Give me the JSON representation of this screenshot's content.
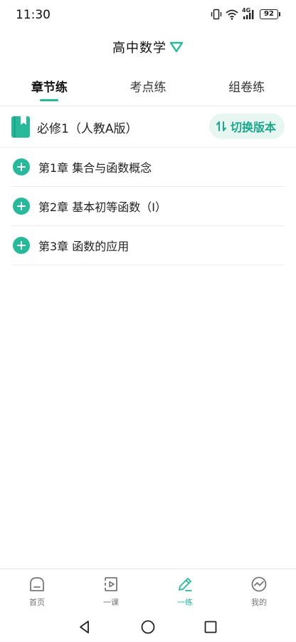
{
  "status_bar": {
    "time": "11:30",
    "network_label": "4G",
    "battery": "92"
  },
  "header": {
    "title": "高中数学",
    "dropdown_icon": "triangle-down-icon"
  },
  "tabs": [
    {
      "label": "章节练",
      "active": true
    },
    {
      "label": "考点练",
      "active": false
    },
    {
      "label": "组卷练",
      "active": false
    }
  ],
  "book": {
    "icon": "book-icon",
    "title": "必修1（人教A版）",
    "switch_label": "切换版本",
    "switch_icon": "swap-vertical-icon"
  },
  "chapters": [
    {
      "label": "第1章  集合与函数概念"
    },
    {
      "label": "第2章  基本初等函数（I）"
    },
    {
      "label": "第3章  函数的应用"
    }
  ],
  "bottom_nav": [
    {
      "label": "首页",
      "icon": "home-icon",
      "active": false
    },
    {
      "label": "一课",
      "icon": "video-lesson-icon",
      "active": false
    },
    {
      "label": "一练",
      "icon": "pencil-practice-icon",
      "active": true
    },
    {
      "label": "我的",
      "icon": "profile-icon",
      "active": false
    }
  ],
  "colors": {
    "accent": "#26b99a",
    "accent_light": "#e8f6f2",
    "text": "#222222",
    "nav_inactive": "#777777"
  }
}
